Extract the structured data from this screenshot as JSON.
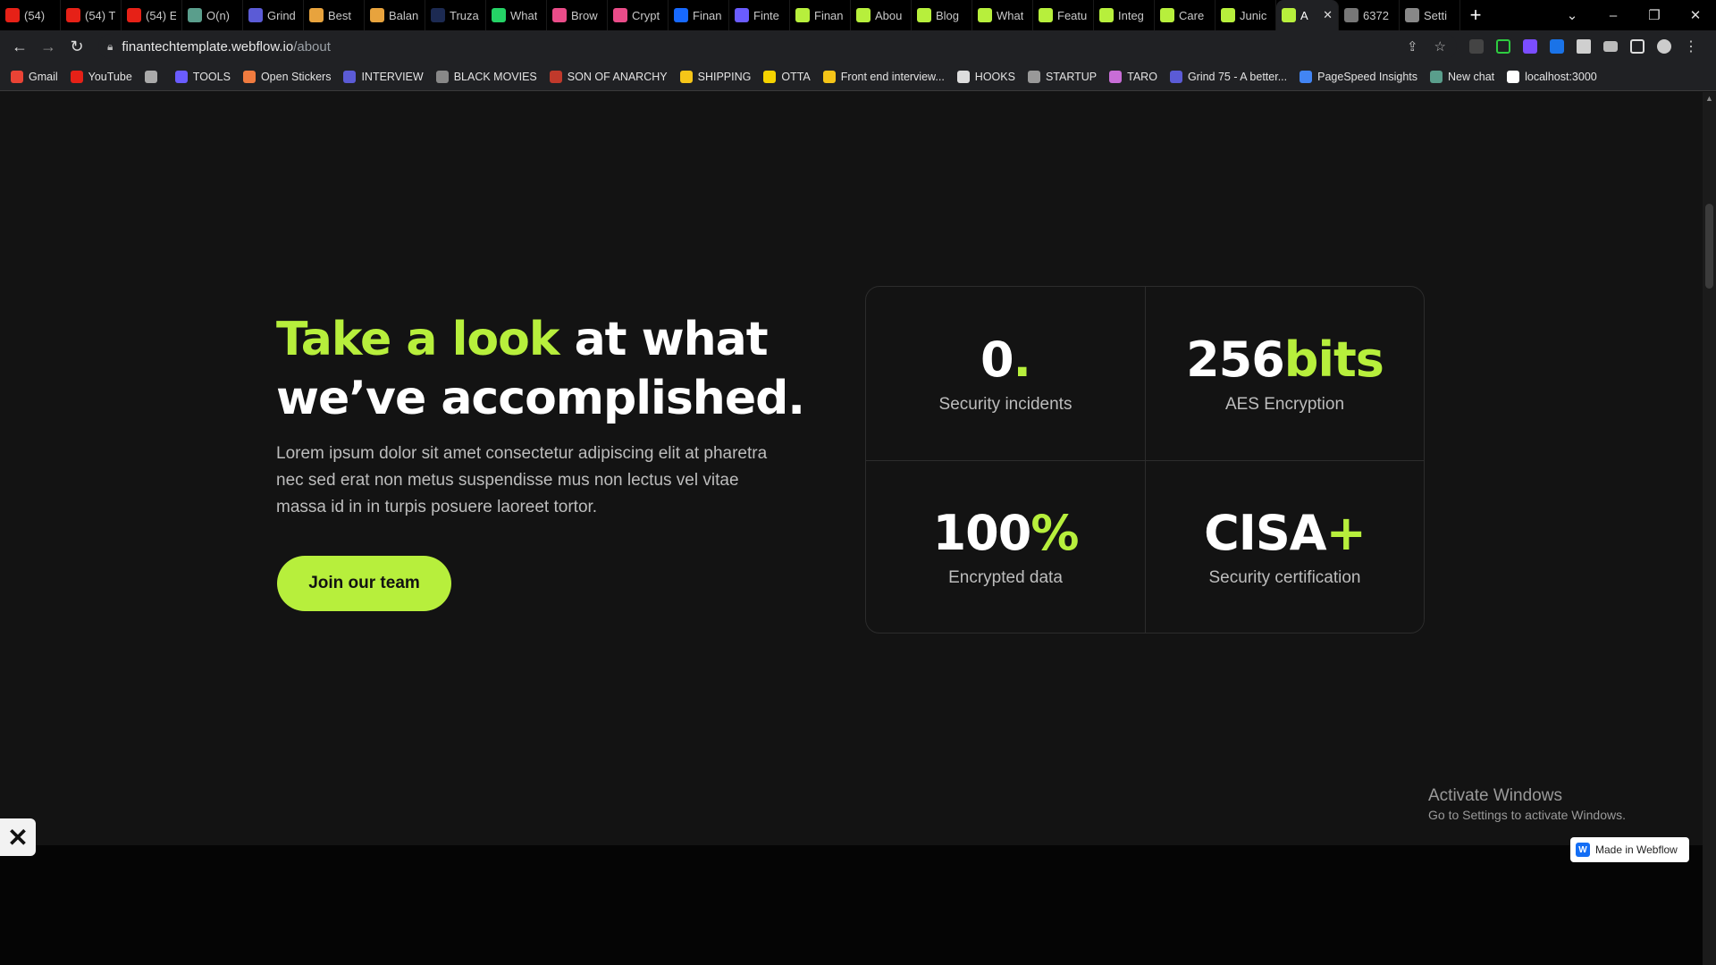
{
  "tabs": [
    {
      "title": "(54)",
      "favicon": "youtube",
      "color": "#e62117"
    },
    {
      "title": "(54) T",
      "favicon": "youtube",
      "color": "#e62117"
    },
    {
      "title": "(54) E",
      "favicon": "youtube",
      "color": "#e62117"
    },
    {
      "title": "O(n)",
      "favicon": "chatgpt",
      "color": "#5a9e8c"
    },
    {
      "title": "Grind",
      "favicon": "grind75",
      "color": "#5b5bd6"
    },
    {
      "title": "Best",
      "favicon": "arrow",
      "color": "#e8a33d"
    },
    {
      "title": "Balan",
      "favicon": "arrow",
      "color": "#e8a33d"
    },
    {
      "title": "Truza",
      "favicon": "truza",
      "color": "#1c2a52"
    },
    {
      "title": "What",
      "favicon": "whatsapp",
      "color": "#25d366"
    },
    {
      "title": "Brow",
      "favicon": "dribbble",
      "color": "#ea4c89"
    },
    {
      "title": "Crypt",
      "favicon": "dribbble",
      "color": "#ea4c89"
    },
    {
      "title": "Finan",
      "favicon": "behance",
      "color": "#1769ff"
    },
    {
      "title": "Finte",
      "favicon": "dots",
      "color": "#6a5cff"
    },
    {
      "title": "Finan",
      "favicon": "webflow-template",
      "color": "#b7ef3c"
    },
    {
      "title": "Abou",
      "favicon": "webflow-template",
      "color": "#b7ef3c"
    },
    {
      "title": "Blog",
      "favicon": "webflow-template",
      "color": "#b7ef3c"
    },
    {
      "title": "What",
      "favicon": "webflow-template",
      "color": "#b7ef3c"
    },
    {
      "title": "Featu",
      "favicon": "webflow-template",
      "color": "#b7ef3c"
    },
    {
      "title": "Integ",
      "favicon": "webflow-template",
      "color": "#b7ef3c"
    },
    {
      "title": "Care",
      "favicon": "webflow-template",
      "color": "#b7ef3c"
    },
    {
      "title": "Junic",
      "favicon": "webflow-template",
      "color": "#b7ef3c"
    },
    {
      "title": "A",
      "favicon": "webflow-template",
      "color": "#b7ef3c",
      "active": true
    },
    {
      "title": "6372",
      "favicon": "globe",
      "color": "#777777"
    },
    {
      "title": "Setti",
      "favicon": "gear",
      "color": "#888888"
    }
  ],
  "address": {
    "host": "finantechtemplate.webflow.io",
    "path": "/about"
  },
  "bookmarks": [
    {
      "label": "Gmail",
      "color": "#ea4335"
    },
    {
      "label": "YouTube",
      "color": "#e62117"
    },
    {
      "label": "",
      "color": "#aaaaaa"
    },
    {
      "label": "TOOLS",
      "color": "#6a5cff"
    },
    {
      "label": "Open Stickers",
      "color": "#f07b3f"
    },
    {
      "label": "INTERVIEW",
      "color": "#5b5bd6"
    },
    {
      "label": "BLACK MOVIES",
      "color": "#888888"
    },
    {
      "label": "SON OF ANARCHY",
      "color": "#c0392b"
    },
    {
      "label": "SHIPPING",
      "color": "#f5c518"
    },
    {
      "label": "OTTA",
      "color": "#f5d300"
    },
    {
      "label": "Front end interview...",
      "color": "#f5c518"
    },
    {
      "label": "HOOKS",
      "color": "#dddddd"
    },
    {
      "label": "STARTUP",
      "color": "#999999"
    },
    {
      "label": "TARO",
      "color": "#c86dd7"
    },
    {
      "label": "Grind 75 - A better...",
      "color": "#5b5bd6"
    },
    {
      "label": "PageSpeed Insights",
      "color": "#4285f4"
    },
    {
      "label": "New chat",
      "color": "#5a9e8c"
    },
    {
      "label": "localhost:3000",
      "color": "#ffffff"
    }
  ],
  "hero": {
    "headline_accent": "Take a look",
    "headline_rest": " at what we’ve accomplished.",
    "body": "Lorem ipsum dolor sit amet consectetur adipiscing elit at pharetra nec sed erat non metus suspendisse mus non lectus vel vitae massa id in in turpis posuere laoreet tortor.",
    "cta": "Join our team"
  },
  "stats": [
    {
      "value": "0",
      "suffix": ".",
      "label": "Security incidents"
    },
    {
      "value": "256",
      "suffix": "bits",
      "label": "AES Encryption"
    },
    {
      "value": "100",
      "suffix": "%",
      "label": "Encrypted data"
    },
    {
      "value": "CISA",
      "suffix": "+",
      "label": "Security certification"
    }
  ],
  "overlay": {
    "windows_title": "Activate Windows",
    "windows_sub": "Go to Settings to activate Windows.",
    "webflow_badge": "Made in Webflow",
    "webflow_badge_mark": "W"
  },
  "accent_color": "#b7ef3c"
}
